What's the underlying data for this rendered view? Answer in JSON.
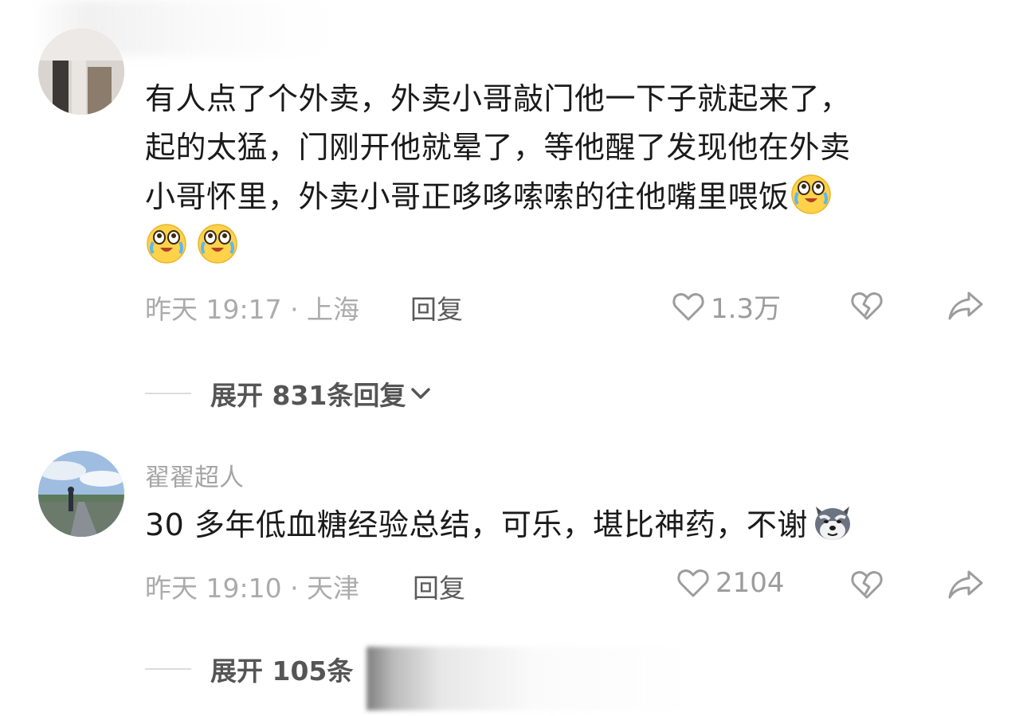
{
  "comments": [
    {
      "text_lines": [
        "有人点了个外卖，外卖小哥敲门他一下子就起来了，",
        "起的太猛，门刚开他就晕了，等他醒了发现他在外卖",
        "小哥怀里，外卖小哥正哆哆嗦嗦的往他嘴里喂饭"
      ],
      "emoji": "laugh-cry-emoji",
      "meta": "昨天 19:17 · 上海",
      "reply_label": "回复",
      "likes": "1.3万",
      "expand_label": "展开 831条回复"
    },
    {
      "username": "翟翟超人",
      "text": "30 多年低血糖经验总结，可乐，堪比神药，不谢",
      "emoji": "husky-emoji",
      "meta": "昨天 19:10 · 天津",
      "reply_label": "回复",
      "likes": "2104",
      "expand_label": "展开 105条"
    }
  ],
  "icons": {
    "like": "heart-outline-icon",
    "dislike": "broken-heart-icon",
    "share": "share-arrow-icon",
    "expand": "chevron-down-icon"
  },
  "colors": {
    "text": "#1a1a1a",
    "meta": "#ababab",
    "reply": "#5a5a5a",
    "expand": "#555555",
    "emoji_yellow": "#ffd24a"
  }
}
